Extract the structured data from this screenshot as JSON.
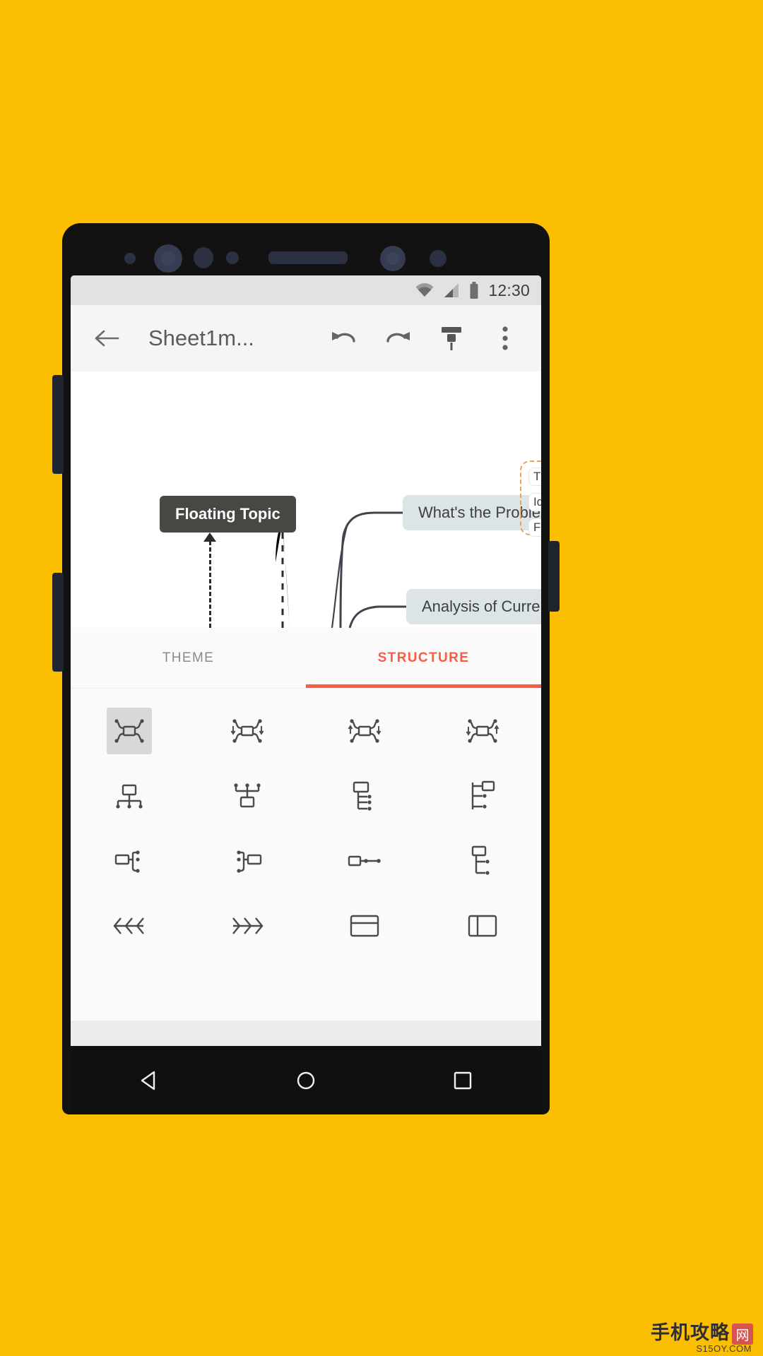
{
  "background_color": "#FBBE00",
  "status_bar": {
    "time": "12:30",
    "icons": [
      "wifi-icon",
      "cellular-signal-icon",
      "battery-icon"
    ]
  },
  "app_bar": {
    "back_icon": "back-arrow-icon",
    "title": "Sheet1m...",
    "undo_icon": "undo-icon",
    "redo_icon": "redo-icon",
    "format_icon": "format-brush-icon",
    "overflow_icon": "more-vertical-icon"
  },
  "canvas": {
    "nodes": [
      {
        "label": "Floating Topic",
        "type": "floating"
      },
      {
        "label": "What's the Problem",
        "type": "subtopic"
      },
      {
        "label": "Analysis of Current Situation",
        "type": "subtopic"
      }
    ],
    "clipped_nodes": [
      {
        "label": "Th"
      },
      {
        "label": "Ide"
      },
      {
        "label": "Fir"
      }
    ],
    "boundary_color": "#f0a050"
  },
  "tabs": {
    "items": [
      {
        "label": "THEME",
        "active": false
      },
      {
        "label": "STRUCTURE",
        "active": true
      }
    ],
    "active_color": "#FB5B42",
    "inactive_color": "#8a8a8a"
  },
  "structures": {
    "selected_index": 0,
    "items": [
      {
        "name": "mind-map-balanced-icon"
      },
      {
        "name": "mind-map-clockwise-icon"
      },
      {
        "name": "mind-map-counter-clockwise-icon"
      },
      {
        "name": "mind-map-free-icon"
      },
      {
        "name": "org-chart-down-icon"
      },
      {
        "name": "org-chart-up-icon"
      },
      {
        "name": "tree-chart-right-icon"
      },
      {
        "name": "logic-chart-right-icon"
      },
      {
        "name": "tree-chart-left-icon"
      },
      {
        "name": "logic-chart-left-icon"
      },
      {
        "name": "timeline-horizontal-icon"
      },
      {
        "name": "logic-chart-right-alt-icon"
      },
      {
        "name": "fishbone-left-icon"
      },
      {
        "name": "fishbone-right-icon"
      },
      {
        "name": "matrix-rows-icon"
      },
      {
        "name": "matrix-columns-icon"
      }
    ]
  },
  "nav_bar": {
    "back_icon": "nav-back-triangle-icon",
    "home_icon": "nav-home-circle-icon",
    "recents_icon": "nav-recents-square-icon"
  },
  "watermark": {
    "text": "手机攻略",
    "badge": "网",
    "url": "S15OY.COM"
  }
}
